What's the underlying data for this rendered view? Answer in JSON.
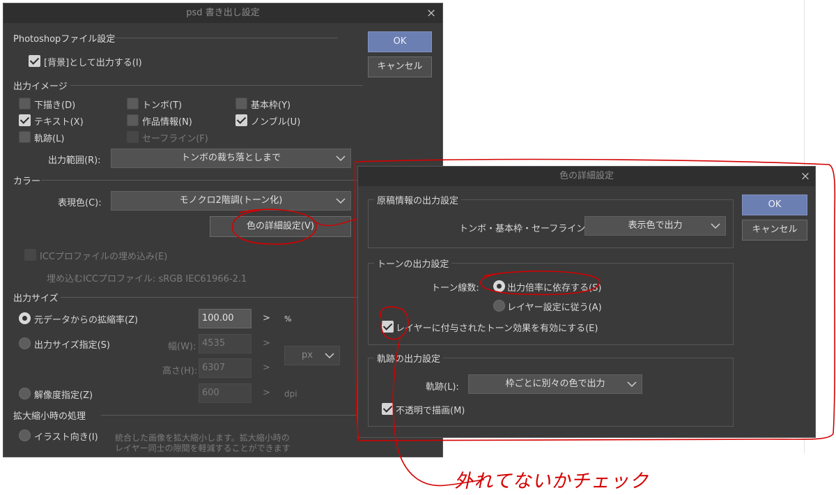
{
  "psd_dialog": {
    "title": "psd 書き出し設定",
    "close": "×",
    "ok": "OK",
    "cancel": "キャンセル",
    "photoshop_section": "Photoshopファイル設定",
    "bg_output": "[背景]として出力する(I)",
    "output_image_section": "出力イメージ",
    "checkboxes": {
      "draft": "下描き(D)",
      "tombo": "トンボ(T)",
      "basic_frame": "基本枠(Y)",
      "text": "テキスト(X)",
      "work_info": "作品情報(N)",
      "nombre": "ノンブル(U)",
      "trace": "軌跡(L)",
      "safe_line": "セーフライン(F)"
    },
    "output_range_label": "出力範囲(R):",
    "output_range_value": "トンボの裁ち落としまで",
    "color_section": "カラー",
    "color_mode_label": "表現色(C):",
    "color_mode_value": "モノクロ2階調(トーン化)",
    "color_detail_button": "色の詳細設定(V)",
    "icc_embed": "ICCプロファイルの埋め込み(E)",
    "icc_profile_line": "埋め込むICCプロファイル: sRGB IEC61966-2.1",
    "output_size_section": "出力サイズ",
    "scale_radio": "元データからの拡縮率(Z)",
    "scale_value": "100.00",
    "scale_unit": "%",
    "size_radio": "出力サイズ指定(S)",
    "width_label": "幅(W):",
    "width_value": "4535",
    "height_label": "高さ(H):",
    "height_value": "6307",
    "size_unit": "px",
    "resolution_radio": "解像度指定(Z)",
    "resolution_value": "600",
    "resolution_unit": "dpi",
    "arrow": ">",
    "scaling_section": "拡大縮小時の処理",
    "illust_radio": "イラスト向き(I)",
    "illust_desc_1": "統合した画像を拡大縮小します。拡大縮小時の",
    "illust_desc_2": "レイヤー同士の隙間を軽減することができます"
  },
  "color_dialog": {
    "title": "色の詳細設定",
    "close": "×",
    "ok": "OK",
    "cancel": "キャンセル",
    "manuscript_section": "原稿情報の出力設定",
    "tombo_label": "トンボ・基本枠・セーフライン(T):",
    "tombo_value": "表示色で出力",
    "tone_section": "トーンの出力設定",
    "tone_lines_label": "トーン線数:",
    "tone_radio_1": "出力倍率に依存する(S)",
    "tone_radio_2": "レイヤー設定に従う(A)",
    "tone_effect_checkbox": "レイヤーに付与されたトーン効果を有効にする(E)",
    "trace_section": "軌跡の出力設定",
    "trace_label": "軌跡(L):",
    "trace_value": "枠ごとに別々の色で出力",
    "opaque_checkbox": "不透明で描画(M)"
  },
  "annotation": {
    "handwritten_note": "外れてないかチェック",
    "ink_color": "#d40000"
  }
}
